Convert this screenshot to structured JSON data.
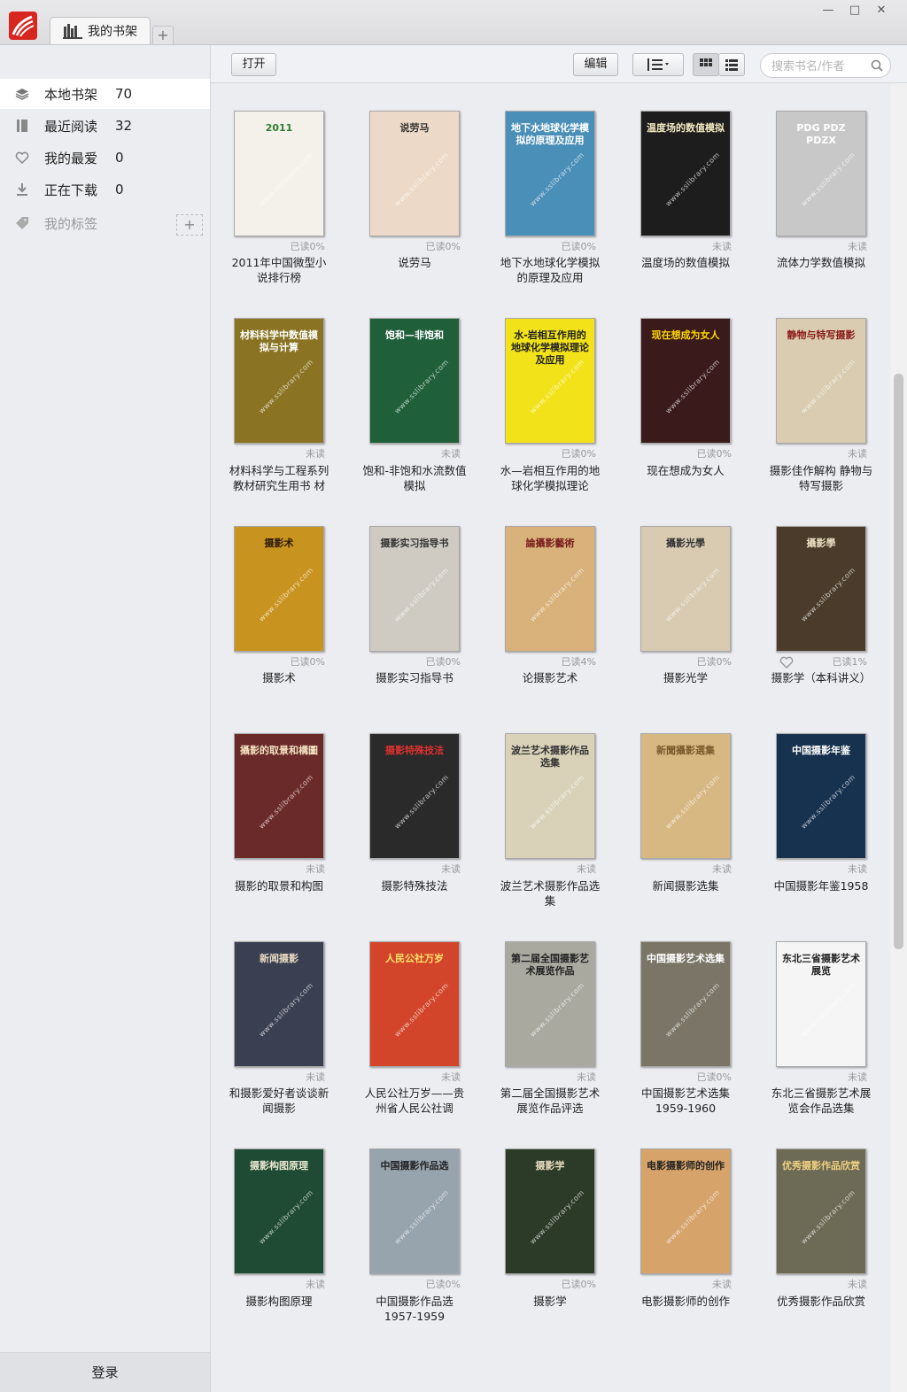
{
  "app": {
    "tab_label": "我的书架",
    "tab_add": "+"
  },
  "sidebar": {
    "items": [
      {
        "label": "本地书架",
        "count": "70",
        "icon": "layers-icon"
      },
      {
        "label": "最近阅读",
        "count": "32",
        "icon": "book-icon"
      },
      {
        "label": "我的最爱",
        "count": "0",
        "icon": "heart-icon"
      },
      {
        "label": "正在下载",
        "count": "0",
        "icon": "download-icon"
      },
      {
        "label": "我的标签",
        "count": "",
        "icon": "tag-icon"
      }
    ],
    "tag_add": "+",
    "login": "登录"
  },
  "toolbar": {
    "open": "打开",
    "edit": "编辑",
    "search_placeholder": "搜索书名/作者"
  },
  "books": [
    {
      "title": "2011年中国微型小说排行榜",
      "status": "已读0%",
      "cover_text": "2011",
      "color": "#f3f1ea",
      "text_color": "#2e7d32"
    },
    {
      "title": "说劳马",
      "status": "已读0%",
      "cover_text": "说劳马",
      "color": "#ecd9c7",
      "text_color": "#333"
    },
    {
      "title": "地下水地球化学模拟的原理及应用",
      "status": "已读0%",
      "cover_text": "地下水地球化学模拟的原理及应用",
      "color": "#4a8fb7",
      "text_color": "#fff"
    },
    {
      "title": "温度场的数值模拟",
      "status": "未读",
      "cover_text": "温度场的数值模拟",
      "color": "#1d1d1d",
      "text_color": "#f0e8c0"
    },
    {
      "title": "流体力学数值模拟",
      "status": "未读",
      "cover_text": "PDG PDZ PDZX",
      "color": "#c8c8c8",
      "text_color": "#fff"
    },
    {
      "title": "材料科学与工程系列教材研究生用书 材",
      "status": "未读",
      "cover_text": "材料科学中数值模拟与计算",
      "color": "#8a7423",
      "text_color": "#fff"
    },
    {
      "title": "饱和-非饱和水流数值模拟",
      "status": "未读",
      "cover_text": "饱和—非饱和",
      "color": "#1f5f3a",
      "text_color": "#fff"
    },
    {
      "title": "水—岩相互作用的地球化学模拟理论",
      "status": "已读0%",
      "cover_text": "水-岩相互作用的地球化学模拟理论及应用",
      "color": "#f2e21a",
      "text_color": "#222"
    },
    {
      "title": "现在想成为女人",
      "status": "已读0%",
      "cover_text": "现在想成为女人",
      "color": "#3a1a1a",
      "text_color": "#ffd700"
    },
    {
      "title": "摄影佳作解构 静物与特写摄影",
      "status": "未读",
      "cover_text": "静物与特写摄影",
      "color": "#d9ccb0",
      "text_color": "#8b1a1a"
    },
    {
      "title": "摄影术",
      "status": "已读0%",
      "cover_text": "摄影术",
      "color": "#c9931f",
      "text_color": "#2b1a0a"
    },
    {
      "title": "摄影实习指导书",
      "status": "已读0%",
      "cover_text": "摄影实习指导书",
      "color": "#cfcbc3",
      "text_color": "#333"
    },
    {
      "title": "论摄影艺术",
      "status": "已读4%",
      "cover_text": "論攝影藝術",
      "color": "#d8b27a",
      "text_color": "#7a1f1f"
    },
    {
      "title": "摄影光学",
      "status": "已读0%",
      "cover_text": "攝影光學",
      "color": "#d8cbb2",
      "text_color": "#333"
    },
    {
      "title": "摄影学（本科讲义）",
      "status": "已读1%",
      "cover_text": "攝影學",
      "color": "#4a3b2b",
      "text_color": "#e8dcc0",
      "favorite": true
    },
    {
      "title": "摄影的取景和构图",
      "status": "未读",
      "cover_text": "攝影的取景和構圖",
      "color": "#6b2a2a",
      "text_color": "#f0e0c0"
    },
    {
      "title": "摄影特殊技法",
      "status": "未读",
      "cover_text": "摄影特殊技法",
      "color": "#2a2a2a",
      "text_color": "#e03030"
    },
    {
      "title": "波兰艺术摄影作品选集",
      "status": "未读",
      "cover_text": "波兰艺术摄影作品选集",
      "color": "#d9d2b8",
      "text_color": "#333"
    },
    {
      "title": "新闻摄影选集",
      "status": "未读",
      "cover_text": "新聞攝影選集",
      "color": "#d7b883",
      "text_color": "#7a5a2a"
    },
    {
      "title": "中国摄影年鉴1958",
      "status": "未读",
      "cover_text": "中国摄影年鉴",
      "color": "#17324f",
      "text_color": "#fff"
    },
    {
      "title": "和摄影爱好者谈谈新闻摄影",
      "status": "未读",
      "cover_text": "新闻摄影",
      "color": "#3b3f52",
      "text_color": "#e8dcc0"
    },
    {
      "title": "人民公社万岁——贵州省人民公社调",
      "status": "未读",
      "cover_text": "人民公社万岁",
      "color": "#d3452a",
      "text_color": "#ffe56b"
    },
    {
      "title": "第二届全国摄影艺术展览作品评选",
      "status": "未读",
      "cover_text": "第二届全国摄影艺术展览作品",
      "color": "#a9a9a0",
      "text_color": "#222"
    },
    {
      "title": "中国摄影艺术选集1959-1960",
      "status": "已读0%",
      "cover_text": "中国摄影艺术选集",
      "color": "#7a7566",
      "text_color": "#fff"
    },
    {
      "title": "东北三省摄影艺术展览会作品选集",
      "status": "未读",
      "cover_text": "东北三省摄影艺术展览",
      "color": "#f5f5f5",
      "text_color": "#222"
    },
    {
      "title": "摄影构图原理",
      "status": "未读",
      "cover_text": "摄影构图原理",
      "color": "#1f4a33",
      "text_color": "#e8e8d0"
    },
    {
      "title": "中国摄影作品选1957-1959",
      "status": "已读0%",
      "cover_text": "中国摄影作品选",
      "color": "#97a3ad",
      "text_color": "#222"
    },
    {
      "title": "摄影学",
      "status": "已读0%",
      "cover_text": "摄影学",
      "color": "#2c3a28",
      "text_color": "#e8dcc0"
    },
    {
      "title": "电影摄影师的创作",
      "status": "未读",
      "cover_text": "电影摄影师的创作",
      "color": "#d6a36a",
      "text_color": "#222"
    },
    {
      "title": "优秀摄影作品欣赏",
      "status": "未读",
      "cover_text": "优秀摄影作品欣赏",
      "color": "#6d6a55",
      "text_color": "#f0d080"
    }
  ],
  "watermark": "www.sslibrary.com"
}
